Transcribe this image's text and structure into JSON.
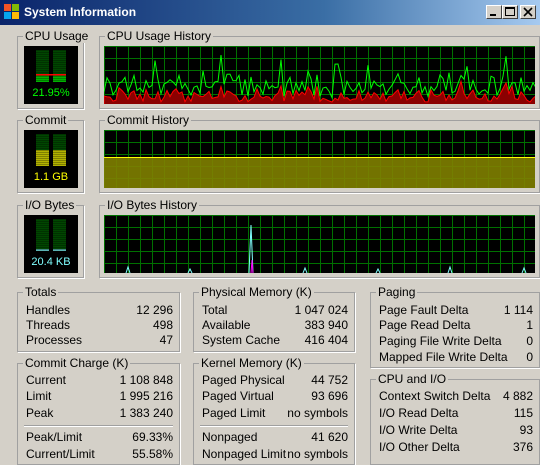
{
  "window": {
    "title": "System Information"
  },
  "cpu": {
    "gauge_label": "CPU Usage",
    "value": "21.95%",
    "level": 0.2195,
    "history_label": "CPU Usage History",
    "color": "#00ff00",
    "kernel_color": "#ff0000"
  },
  "commit": {
    "gauge_label": "Commit",
    "value": "1.1 GB",
    "level": 0.5,
    "history_label": "Commit History",
    "color": "#ffff00"
  },
  "io": {
    "gauge_label": "I/O Bytes",
    "value": "20.4  KB",
    "level": 0.05,
    "history_label": "I/O Bytes History",
    "color": "#80ffff",
    "write_color": "#ff00ff"
  },
  "totals": {
    "title": "Totals",
    "rows": [
      {
        "label": "Handles",
        "value": "12 296"
      },
      {
        "label": "Threads",
        "value": "498"
      },
      {
        "label": "Processes",
        "value": "47"
      }
    ]
  },
  "physical_memory": {
    "title": "Physical Memory (K)",
    "rows": [
      {
        "label": "Total",
        "value": "1 047 024"
      },
      {
        "label": "Available",
        "value": "383 940"
      },
      {
        "label": "System Cache",
        "value": "416 404"
      }
    ]
  },
  "paging": {
    "title": "Paging",
    "rows": [
      {
        "label": "Page Fault Delta",
        "value": "1 114"
      },
      {
        "label": "Page Read Delta",
        "value": "1"
      },
      {
        "label": "Paging File Write Delta",
        "value": "0"
      },
      {
        "label": "Mapped File Write Delta",
        "value": "0"
      }
    ]
  },
  "commit_charge": {
    "title": "Commit Charge (K)",
    "rows": [
      {
        "label": "Current",
        "value": "1 108 848"
      },
      {
        "label": "Limit",
        "value": "1 995 216"
      },
      {
        "label": "Peak",
        "value": "1 383 240"
      },
      {
        "label": "Peak/Limit",
        "value": "69.33%"
      },
      {
        "label": "Current/Limit",
        "value": "55.58%"
      }
    ]
  },
  "kernel_memory": {
    "title": "Kernel Memory (K)",
    "rows": [
      {
        "label": "Paged Physical",
        "value": "44 752"
      },
      {
        "label": "Paged Virtual",
        "value": "93 696"
      },
      {
        "label": "Paged Limit",
        "value": "no symbols"
      },
      {
        "label": "Nonpaged",
        "value": "41 620"
      },
      {
        "label": "Nonpaged Limit",
        "value": "no symbols"
      }
    ]
  },
  "cpu_io": {
    "title": "CPU and I/O",
    "rows": [
      {
        "label": "Context Switch Delta",
        "value": "4 882"
      },
      {
        "label": "I/O Read Delta",
        "value": "115"
      },
      {
        "label": "I/O Write Delta",
        "value": "93"
      },
      {
        "label": "I/O Other Delta",
        "value": "376"
      }
    ]
  }
}
